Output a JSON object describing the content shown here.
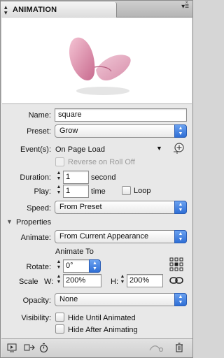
{
  "panel": {
    "title": "ANIMATION",
    "close_glyph": "×",
    "menu_glyph": "▾≡"
  },
  "form": {
    "name_label": "Name:",
    "name_value": "square",
    "preset_label": "Preset:",
    "preset_value": "Grow",
    "events_label": "Event(s):",
    "events_value": "On Page Load",
    "reverse_label": "Reverse on Roll Off",
    "duration_label": "Duration:",
    "duration_value": "1",
    "duration_unit": "second",
    "play_label": "Play:",
    "play_value": "1",
    "play_unit": "time",
    "loop_label": "Loop",
    "speed_label": "Speed:",
    "speed_value": "From Preset"
  },
  "properties": {
    "section_label": "Properties",
    "animate_label": "Animate:",
    "animate_value": "From Current Appearance",
    "animate_to_label": "Animate To",
    "rotate_label": "Rotate:",
    "rotate_value": "0°",
    "scale_label": "Scale",
    "w_label": "W:",
    "w_value": "200%",
    "h_label": "H:",
    "h_value": "200%",
    "opacity_label": "Opacity:",
    "opacity_value": "None",
    "visibility_label": "Visibility:",
    "hide_until_label": "Hide Until Animated",
    "hide_after_label": "Hide After Animating"
  },
  "colors": {
    "accent": "#2f6fd6",
    "butterfly_pink": "#d98aa8"
  }
}
